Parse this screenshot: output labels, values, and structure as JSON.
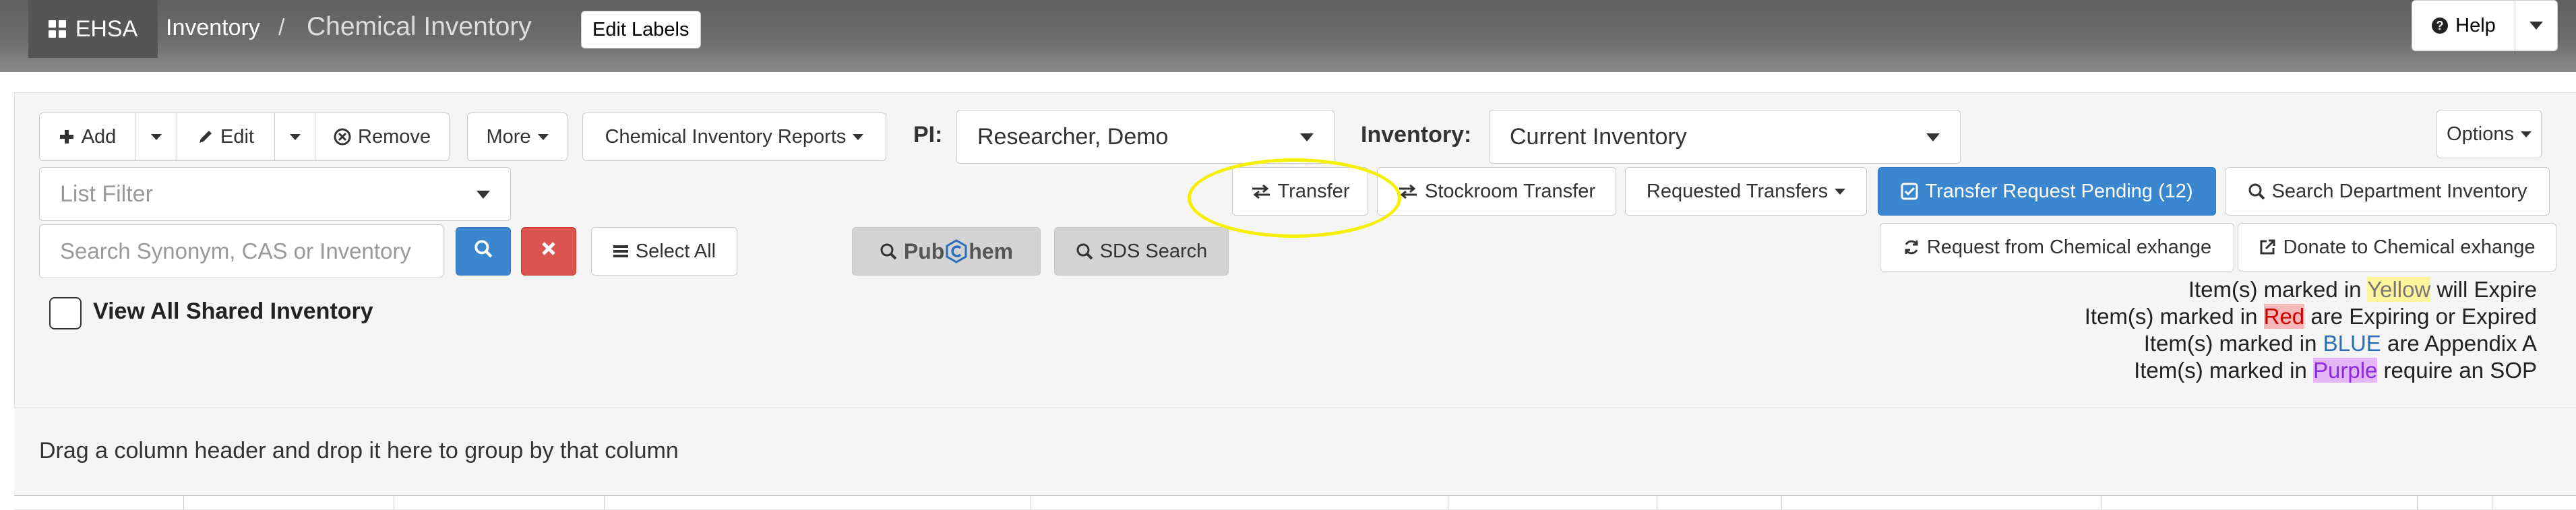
{
  "navbar": {
    "brand": "EHSA",
    "breadcrumb": [
      "Inventory",
      "/",
      "Chemical Inventory"
    ],
    "edit_labels": "Edit Labels",
    "help": "Help"
  },
  "toolbar": {
    "add": "Add",
    "edit": "Edit",
    "remove": "Remove",
    "more": "More",
    "reports": "Chemical Inventory Reports",
    "pi_label": "PI:",
    "pi_value": "Researcher, Demo",
    "inventory_label": "Inventory:",
    "inventory_value": "Current Inventory",
    "options": "Options"
  },
  "filter": {
    "list_filter_placeholder": "List Filter",
    "search_placeholder": "Search Synonym, CAS or Inventory",
    "select_all": "Select All"
  },
  "transfer": {
    "transfer": "Transfer",
    "stockroom_transfer": "Stockroom Transfer",
    "requested_transfers": "Requested Transfers",
    "transfer_request_pending": "Transfer Request Pending (12)",
    "search_department": "Search Department Inventory",
    "request_from_exchange": "Request from Chemical exhange",
    "donate_to_exchange": "Donate to Chemical exhange"
  },
  "lookup": {
    "pubchem_prefix": "Pub",
    "pubchem_suffix": "hem",
    "sds_search": "SDS Search"
  },
  "view_all_shared": "View All Shared Inventory",
  "legend": [
    {
      "prefix": "Item(s) marked in ",
      "highlight": "Yellow",
      "suffix": " will Expire",
      "color": "#fff59d"
    },
    {
      "prefix": "Item(s) marked in ",
      "highlight": "Red",
      "suffix": " are Expiring or Expired",
      "color": "#f5b7b7"
    },
    {
      "prefix": "Item(s) marked in ",
      "highlight": "BLUE",
      "suffix": " are Appendix A",
      "color": "#2a6ebb"
    },
    {
      "prefix": "Item(s) marked in ",
      "highlight": "Purple",
      "suffix": " require an SOP",
      "color": "#e5b6f5"
    }
  ],
  "group_by_hint": "Drag a column header and drop it here to group by that column",
  "icons": [
    "grid-icon",
    "plus-icon",
    "pencil-icon",
    "times-circle-icon",
    "exchange-icon",
    "search-icon",
    "times-icon",
    "list-icon",
    "refresh-icon",
    "external-link-icon",
    "check-square-icon",
    "question-circle-icon"
  ],
  "colors": {
    "primary": "#3a87cf",
    "danger": "#d9534f",
    "navbar": "#6d6d6d",
    "annotation": "#f6f000"
  }
}
